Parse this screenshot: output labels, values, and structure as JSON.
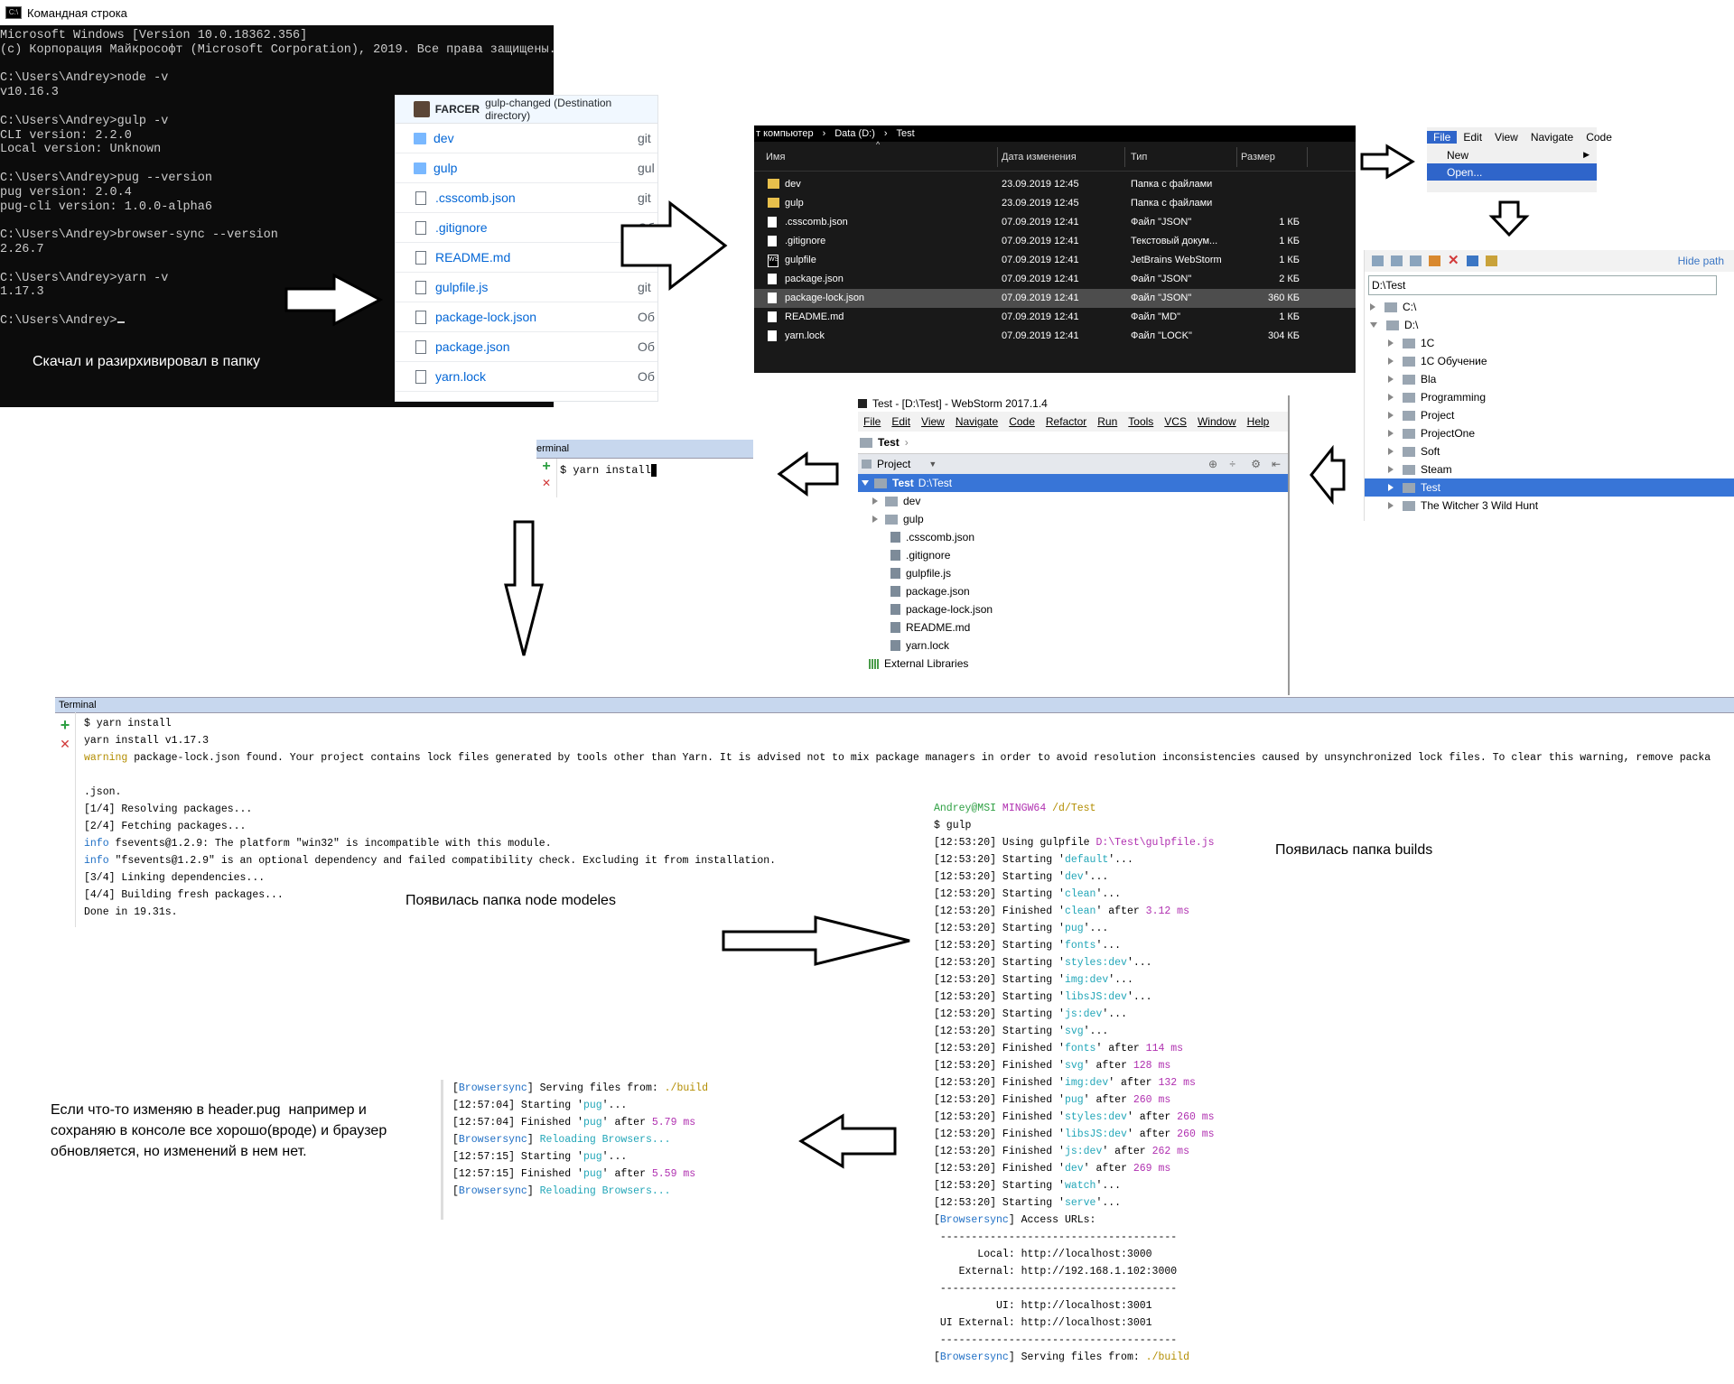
{
  "cmd": {
    "title": "Командная строка",
    "lines": [
      "Microsoft Windows [Version 10.0.18362.356]",
      "(c) Корпорация Майкрософт (Microsoft Corporation), 2019. Все права защищены.",
      "",
      "C:\\Users\\Andrey>node -v",
      "v10.16.3",
      "",
      "C:\\Users\\Andrey>gulp -v",
      "CLI version: 2.2.0",
      "Local version: Unknown",
      "",
      "C:\\Users\\Andrey>pug --version",
      "pug version: 2.0.4",
      "pug-cli version: 1.0.0-alpha6",
      "",
      "C:\\Users\\Andrey>browser-sync --version",
      "2.26.7",
      "",
      "C:\\Users\\Andrey>yarn -v",
      "1.17.3",
      "",
      "C:\\Users\\Andrey>"
    ],
    "note": "Скачал и разирхивировал в папку"
  },
  "github": {
    "header_user": "FARCER",
    "header_msg": "gulp-changed (Destination directory)",
    "files": [
      {
        "name": "dev",
        "type": "folder",
        "msg": "git"
      },
      {
        "name": "gulp",
        "type": "folder",
        "msg": "gul"
      },
      {
        "name": ".csscomb.json",
        "type": "file",
        "msg": "git"
      },
      {
        "name": ".gitignore",
        "type": "file",
        "msg": "Об"
      },
      {
        "name": "README.md",
        "type": "file",
        "msg": "Об"
      },
      {
        "name": "gulpfile.js",
        "type": "file",
        "msg": "git"
      },
      {
        "name": "package-lock.json",
        "type": "file",
        "msg": "Об"
      },
      {
        "name": "package.json",
        "type": "file",
        "msg": "Об"
      },
      {
        "name": "yarn.lock",
        "type": "file",
        "msg": "Об"
      }
    ]
  },
  "explorer": {
    "breadcrumb": [
      "т компьютер",
      "Data (D:)",
      "Test"
    ],
    "columns": [
      "Имя",
      "Дата изменения",
      "Тип",
      "Размер"
    ],
    "rows": [
      {
        "name": "dev",
        "date": "23.09.2019 12:45",
        "type": "Папка с файлами",
        "size": "",
        "icon": "folder"
      },
      {
        "name": "gulp",
        "date": "23.09.2019 12:45",
        "type": "Папка с файлами",
        "size": "",
        "icon": "folder"
      },
      {
        "name": ".csscomb.json",
        "date": "07.09.2019 12:41",
        "type": "Файл \"JSON\"",
        "size": "1 КБ",
        "icon": "doc"
      },
      {
        "name": ".gitignore",
        "date": "07.09.2019 12:41",
        "type": "Текстовый докум...",
        "size": "1 КБ",
        "icon": "doc"
      },
      {
        "name": "gulpfile",
        "date": "07.09.2019 12:41",
        "type": "JetBrains WebStorm",
        "size": "1 КБ",
        "icon": "ws"
      },
      {
        "name": "package.json",
        "date": "07.09.2019 12:41",
        "type": "Файл \"JSON\"",
        "size": "2 КБ",
        "icon": "doc"
      },
      {
        "name": "package-lock.json",
        "date": "07.09.2019 12:41",
        "type": "Файл \"JSON\"",
        "size": "360 КБ",
        "icon": "doc",
        "selected": true
      },
      {
        "name": "README.md",
        "date": "07.09.2019 12:41",
        "type": "Файл \"MD\"",
        "size": "1 КБ",
        "icon": "doc"
      },
      {
        "name": "yarn.lock",
        "date": "07.09.2019 12:41",
        "type": "Файл \"LOCK\"",
        "size": "304 КБ",
        "icon": "doc"
      }
    ]
  },
  "ws_menu": {
    "bar": [
      "File",
      "Edit",
      "View",
      "Navigate",
      "Code"
    ],
    "items": [
      "New",
      "Open..."
    ]
  },
  "open_dialog": {
    "hide_path": "Hide path",
    "path_value": "D:\\Test",
    "tree": [
      {
        "label": "C:\\",
        "level": 0,
        "expanded": false
      },
      {
        "label": "D:\\",
        "level": 0,
        "expanded": true
      },
      {
        "label": "1C",
        "level": 1
      },
      {
        "label": "1С Обучение",
        "level": 1
      },
      {
        "label": "Bla",
        "level": 1
      },
      {
        "label": "Programming",
        "level": 1
      },
      {
        "label": "Project",
        "level": 1
      },
      {
        "label": "ProjectOne",
        "level": 1
      },
      {
        "label": "Soft",
        "level": 1
      },
      {
        "label": "Steam",
        "level": 1
      },
      {
        "label": "Test",
        "level": 1,
        "selected": true
      },
      {
        "label": "The Witcher 3 Wild Hunt",
        "level": 1
      }
    ]
  },
  "webstorm": {
    "title": "Test - [D:\\Test] - WebStorm 2017.1.4",
    "menu": [
      "File",
      "Edit",
      "View",
      "Navigate",
      "Code",
      "Refactor",
      "Run",
      "Tools",
      "VCS",
      "Window",
      "Help"
    ],
    "nav": "Test",
    "panel": "Project",
    "root_name": "Test",
    "root_path": "D:\\Test",
    "tree": [
      {
        "label": "dev",
        "kind": "folder"
      },
      {
        "label": "gulp",
        "kind": "folder"
      },
      {
        "label": ".csscomb.json",
        "kind": "file"
      },
      {
        "label": ".gitignore",
        "kind": "file"
      },
      {
        "label": "gulpfile.js",
        "kind": "file"
      },
      {
        "label": "package.json",
        "kind": "file"
      },
      {
        "label": "package-lock.json",
        "kind": "file"
      },
      {
        "label": "README.md",
        "kind": "file"
      },
      {
        "label": "yarn.lock",
        "kind": "file"
      }
    ],
    "external": "External Libraries"
  },
  "small_terminal": {
    "title": "erminal",
    "command": "$ yarn install"
  },
  "big_terminal": {
    "title": "Terminal",
    "lines": [
      "$ yarn install",
      "yarn install v1.17.3",
      "warning package-lock.json found. Your project contains lock files generated by tools other than Yarn. It is advised not to mix package managers in order to avoid resolution inconsistencies caused by unsynchronized lock files. To clear this warning, remove packa",
      "",
      ".json.",
      "[1/4] Resolving packages...",
      "[2/4] Fetching packages...",
      "info fsevents@1.2.9: The platform \"win32\" is incompatible with this module.",
      "info \"fsevents@1.2.9\" is an optional dependency and failed compatibility check. Excluding it from installation.",
      "[3/4] Linking dependencies...",
      "[4/4] Building fresh packages...",
      "Done in 19.31s."
    ]
  },
  "notes": {
    "node_modules": "Появилась папка node modeles",
    "builds": "Появилась папка builds",
    "problem_1": "Если что-то изменяю в header.pug  например и",
    "problem_2": "сохраняю в консоле все хорошо(вроде) и браузер",
    "problem_3": "обновляется, но изменений в нем нет."
  },
  "gulp_output": {
    "prompt_user": "Andrey@MSI",
    "prompt_env": "MINGW64",
    "prompt_dir": "/d/Test",
    "command": "$ gulp",
    "lines": [
      [
        "[12:53:20] Using gulpfile ",
        "D:\\Test\\gulpfile.js",
        ""
      ],
      [
        "[12:53:20] Starting '",
        "default",
        "'..."
      ],
      [
        "[12:53:20] Starting '",
        "dev",
        "'..."
      ],
      [
        "[12:53:20] Starting '",
        "clean",
        "'..."
      ],
      [
        "[12:53:20] Finished '",
        "clean",
        "' after ",
        "3.12 ms"
      ],
      [
        "[12:53:20] Starting '",
        "pug",
        "'..."
      ],
      [
        "[12:53:20] Starting '",
        "fonts",
        "'..."
      ],
      [
        "[12:53:20] Starting '",
        "styles:dev",
        "'..."
      ],
      [
        "[12:53:20] Starting '",
        "img:dev",
        "'..."
      ],
      [
        "[12:53:20] Starting '",
        "libsJS:dev",
        "'..."
      ],
      [
        "[12:53:20] Starting '",
        "js:dev",
        "'..."
      ],
      [
        "[12:53:20] Starting '",
        "svg",
        "'..."
      ],
      [
        "[12:53:20] Finished '",
        "fonts",
        "' after ",
        "114 ms"
      ],
      [
        "[12:53:20] Finished '",
        "svg",
        "' after ",
        "128 ms"
      ],
      [
        "[12:53:20] Finished '",
        "img:dev",
        "' after ",
        "132 ms"
      ],
      [
        "[12:53:20] Finished '",
        "pug",
        "' after ",
        "260 ms"
      ],
      [
        "[12:53:20] Finished '",
        "styles:dev",
        "' after ",
        "260 ms"
      ],
      [
        "[12:53:20] Finished '",
        "libsJS:dev",
        "' after ",
        "260 ms"
      ],
      [
        "[12:53:20] Finished '",
        "js:dev",
        "' after ",
        "262 ms"
      ],
      [
        "[12:53:20] Finished '",
        "dev",
        "' after ",
        "269 ms"
      ],
      [
        "[12:53:20] Starting '",
        "watch",
        "'..."
      ],
      [
        "[12:53:20] Starting '",
        "serve",
        "'..."
      ]
    ],
    "access": "Access URLs:",
    "sep": " --------------------------------------",
    "local": "       Local: http://localhost:3000",
    "external": "    External: http://192.168.1.102:3000",
    "ui": "          UI: http://localhost:3001",
    "ui_external": " UI External: http://localhost:3001",
    "serving": "Serving files from: ",
    "serving_dir": "./build",
    "bs": "Browsersync"
  },
  "bs_output": {
    "bs": "Browsersync",
    "serving": "] Serving files from: ",
    "serving_dir": "./build",
    "reload": "Reloading Browsers...",
    "lines": [
      [
        "[12:57:04] Starting '",
        "pug",
        "'..."
      ],
      [
        "[12:57:04] Finished '",
        "pug",
        "' after ",
        "5.79 ms"
      ],
      [
        "[12:57:15] Starting '",
        "pug",
        "'..."
      ],
      [
        "[12:57:15] Finished '",
        "pug",
        "' after ",
        "5.59 ms"
      ]
    ]
  },
  "colors": {
    "cmd_bg": "#0c0c0c",
    "explorer_bg": "#191919",
    "selection_blue": "#3875d7",
    "term_yellow": "#b38d00",
    "term_blue": "#1f6fc5",
    "term_magenta": "#b030b0",
    "term_cyan": "#22a6b8",
    "term_green": "#2ea043"
  }
}
